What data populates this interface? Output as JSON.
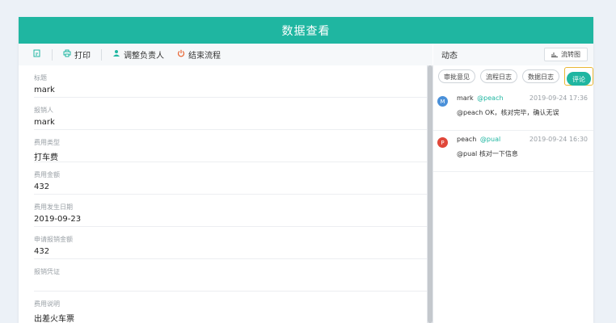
{
  "header": {
    "title": "数据查看"
  },
  "toolbar": {
    "print_label": "打印",
    "reassign_label": "调整负责人",
    "end_flow_label": "结束流程"
  },
  "form": {
    "fields": [
      {
        "label": "标题",
        "value": "mark"
      },
      {
        "label": "报销人",
        "value": "mark"
      },
      {
        "label": "费用类型",
        "value": "打车费"
      },
      {
        "label": "费用金额",
        "value": "432"
      },
      {
        "label": "费用发生日期",
        "value": "2019-09-23"
      },
      {
        "label": "申请报销金额",
        "value": "432"
      },
      {
        "label": "报销凭证",
        "value": ""
      },
      {
        "label": "费用说明",
        "value": "出差火车票"
      }
    ]
  },
  "activity": {
    "title": "动态",
    "flow_button_label": "流转图",
    "tabs": [
      {
        "label": "审批意见"
      },
      {
        "label": "流程日志"
      },
      {
        "label": "数据日志"
      },
      {
        "label": "评论"
      }
    ],
    "comments": [
      {
        "avatar_letter": "M",
        "avatar_color": "#4a90d9",
        "user": "mark",
        "mention": "@peach",
        "time": "2019-09-24 17:36",
        "text": "@peach OK，核对完毕，确认无误"
      },
      {
        "avatar_letter": "P",
        "avatar_color": "#e0473a",
        "user": "peach",
        "mention": "@pual",
        "time": "2019-09-24 16:30",
        "text": "@pual 核对一下信息"
      }
    ]
  },
  "colors": {
    "accent": "#1fb6a1",
    "highlight": "#e9b733",
    "power": "#e9622e"
  }
}
